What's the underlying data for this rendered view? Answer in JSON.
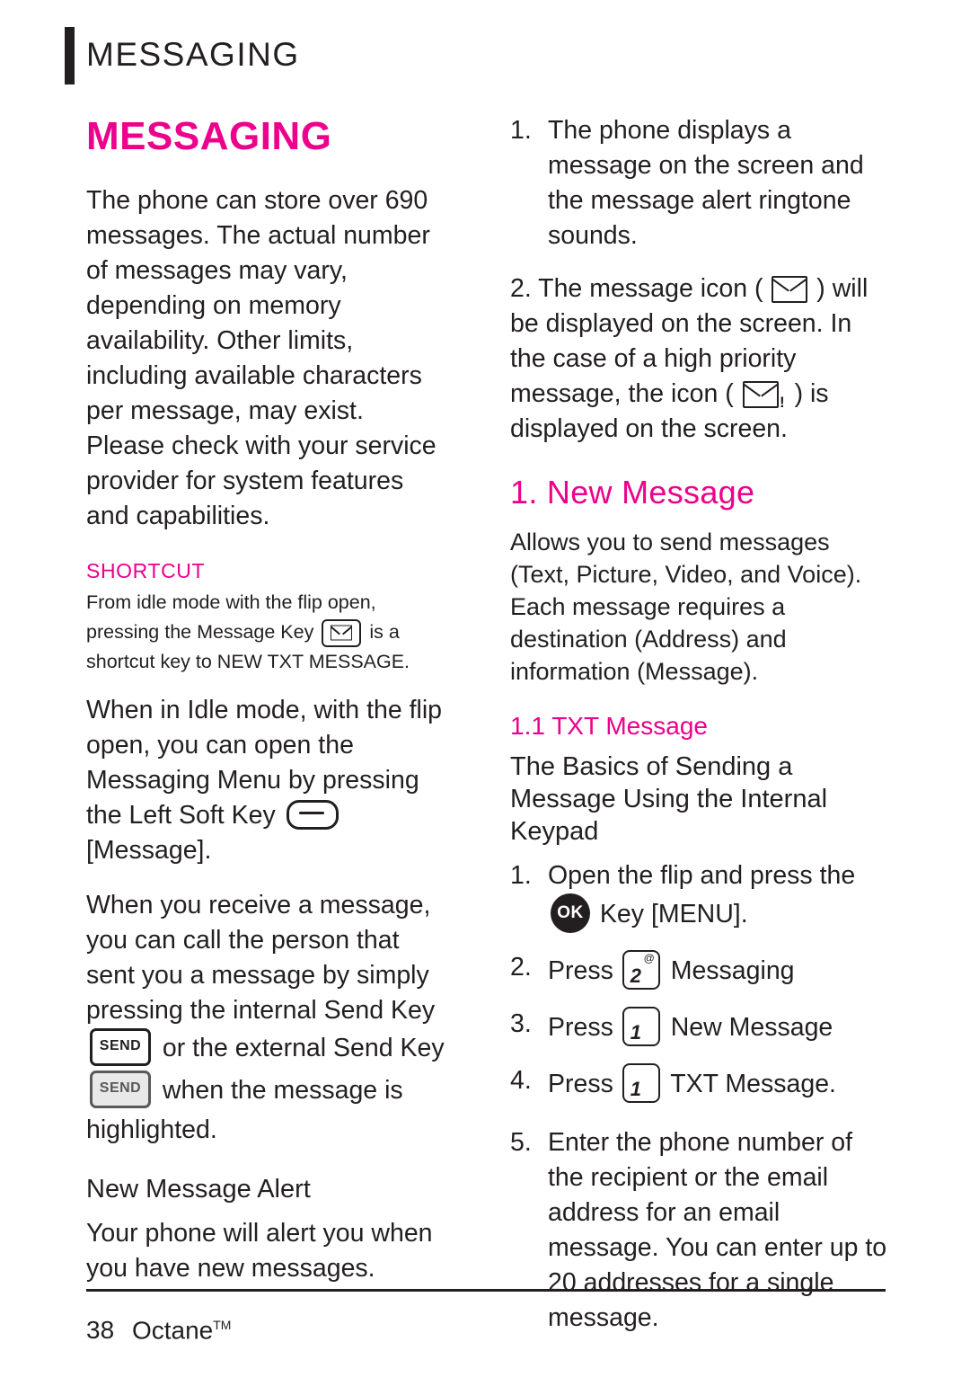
{
  "header": {
    "running_title": "MESSAGING"
  },
  "left": {
    "section_title": "MESSAGING",
    "intro": "The phone can store over 690 messages. The actual number of messages may vary, depending on memory availability. Other limits, including available characters per message, may exist. Please check with your service provider for system features and capabilities.",
    "shortcut_label": "SHORTCUT",
    "shortcut_pre": "From idle mode with the flip open, pressing the Message Key",
    "shortcut_post": "is a shortcut key to NEW TXT MESSAGE.",
    "idle_pre": "When in Idle mode, with the flip open, you can open the Messaging Menu by pressing the Left Soft Key",
    "idle_post": "[Message].",
    "receive_pre": "When you receive a message, you can call the person that sent you a message by simply pressing the internal Send Key",
    "receive_mid": "or the external Send Key",
    "receive_post": "when the message is highlighted.",
    "alert_heading": "New Message Alert",
    "alert_body": "Your phone will alert you when you have new messages.",
    "send_key_label": "SEND"
  },
  "right": {
    "alert_steps": [
      {
        "num": "1.",
        "text": "The phone displays a message on the screen and the message alert ringtone sounds."
      }
    ],
    "step2_pre": "2. The message icon (",
    "step2_mid": ") will be displayed on the screen. In the case of a high priority message, the icon (",
    "step2_post": ") is displayed on the screen.",
    "new_message_heading": "1. New Message",
    "new_message_body": "Allows you to send messages (Text, Picture, Video, and Voice). Each message requires a destination (Address) and information (Message).",
    "txt_message_heading": "1.1 TXT Message",
    "basics_heading": "The Basics of Sending a Message Using the Internal Keypad",
    "steps": [
      {
        "num": "1.",
        "pre": "Open the flip and press the",
        "post": "Key [MENU]."
      },
      {
        "num": "2.",
        "pre": "Press",
        "key": "2",
        "sup": "@",
        "post": "Messaging"
      },
      {
        "num": "3.",
        "pre": "Press",
        "key": "1",
        "sup": "",
        "post": "New Message"
      },
      {
        "num": "4.",
        "pre": "Press",
        "key": "1",
        "sup": "",
        "post": "TXT Message."
      },
      {
        "num": "5.",
        "pre": "",
        "key": "",
        "sup": "",
        "post": "Enter the phone number of the recipient or the email address for an email message. You can enter up to 20 addresses for a single message."
      }
    ],
    "ok_key_label": "OK"
  },
  "footer": {
    "page_number": "38",
    "product": "Octane",
    "trademark": "TM"
  },
  "colors": {
    "accent": "#ec008c",
    "text": "#231f20"
  }
}
